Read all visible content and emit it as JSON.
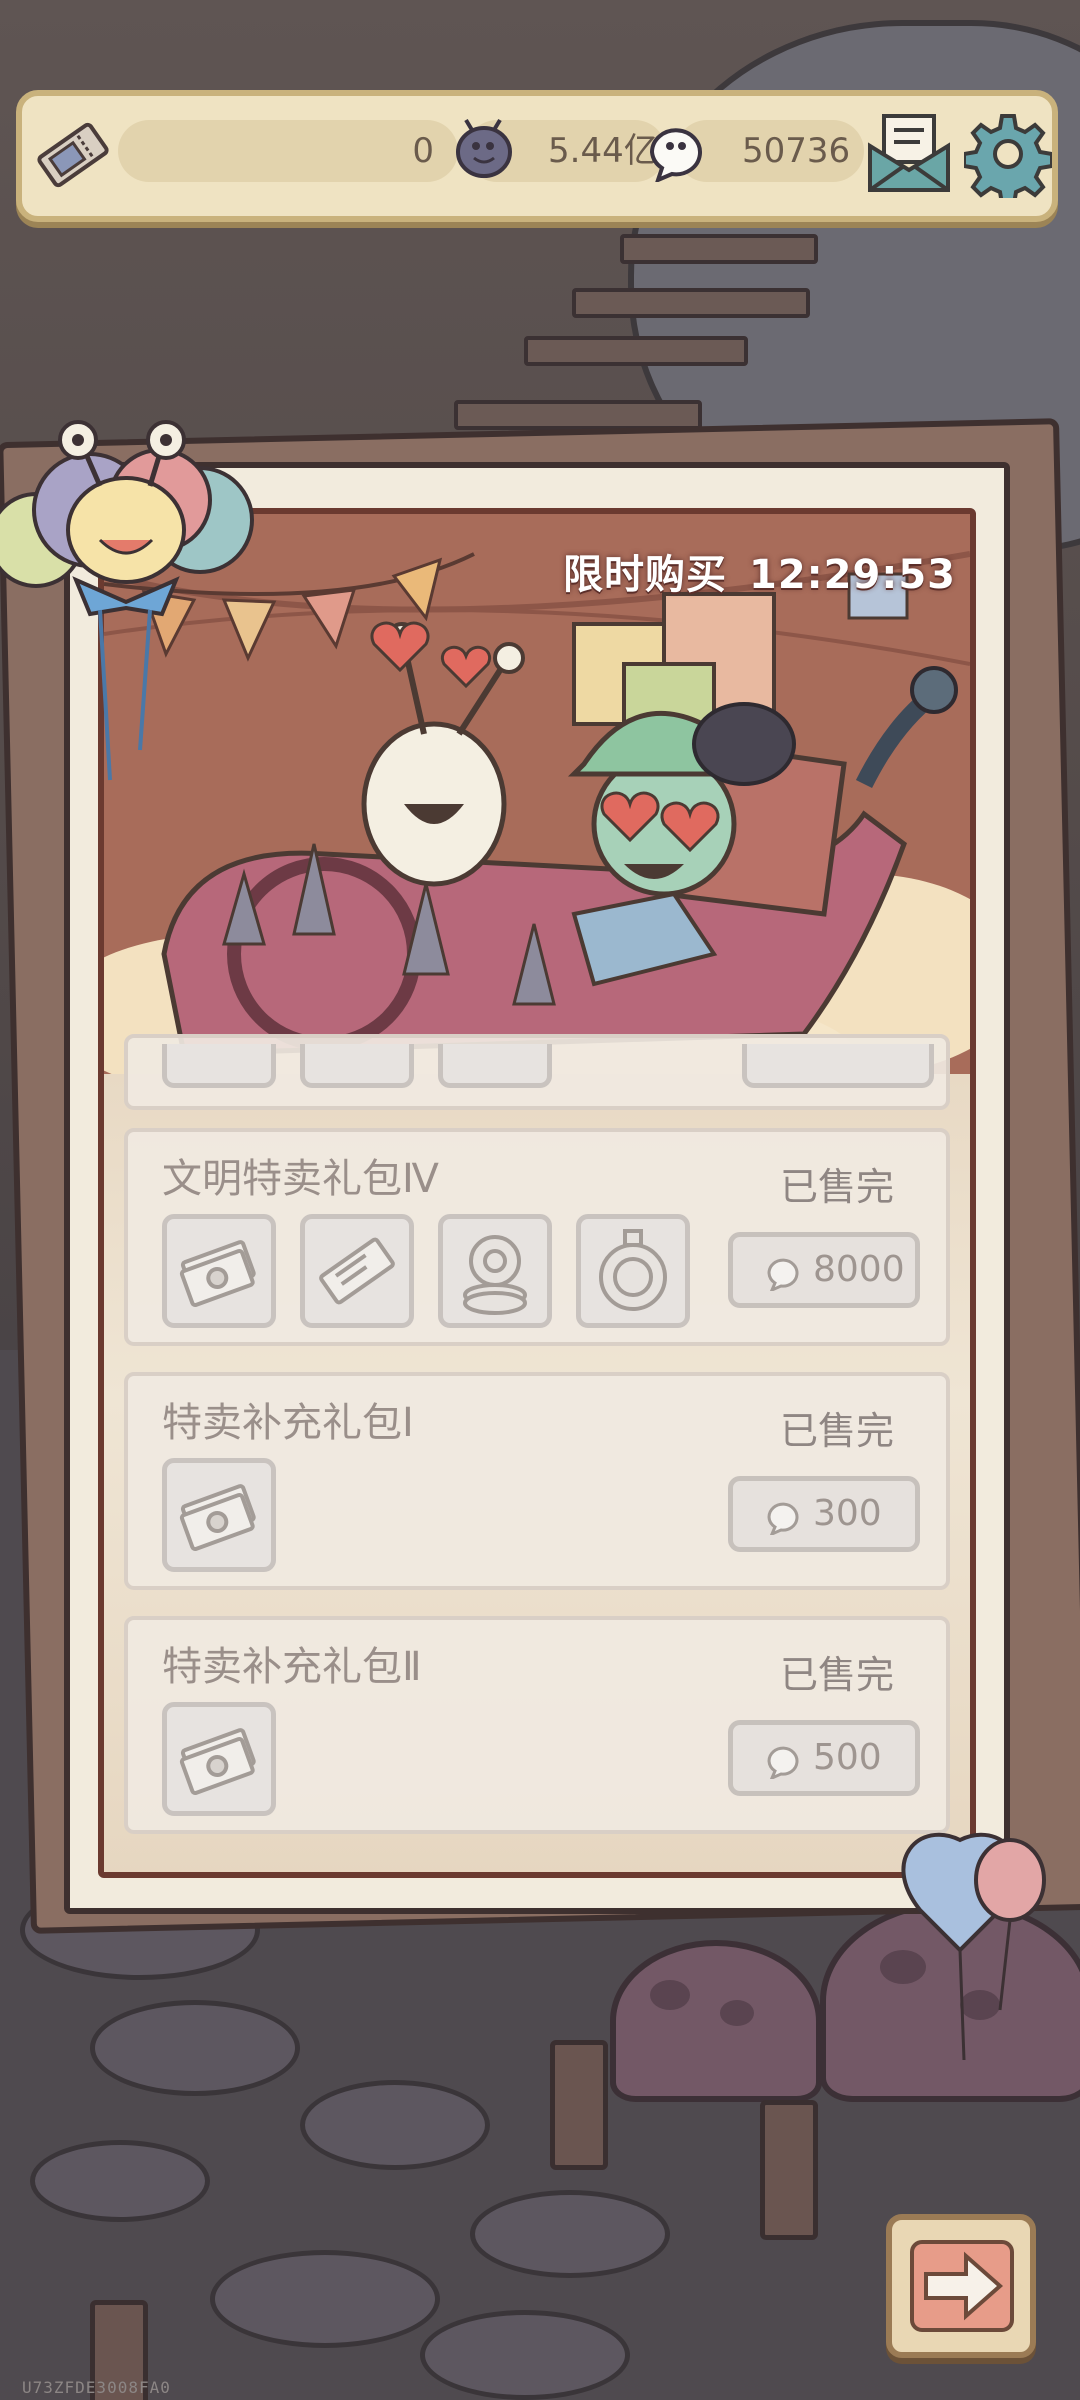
{
  "currency": {
    "tickets": "0",
    "coins": "5.44亿",
    "gems": "50736"
  },
  "icons": {
    "ticket": "ticket-icon",
    "coin": "snail-coin-icon",
    "gem": "white-snail-gem-icon",
    "mail": "mail-icon",
    "settings": "gear-icon",
    "next": "arrow-right-icon"
  },
  "banner": {
    "label": "限时购买",
    "countdown": "12:29:53"
  },
  "packs": [
    {
      "name": "文明特卖礼包Ⅳ",
      "status": "已售完",
      "price": "8000",
      "items": [
        "ticket-bundle-icon",
        "ticket-icon",
        "gear-coins-icon",
        "medal-coin-icon"
      ]
    },
    {
      "name": "特卖补充礼包Ⅰ",
      "status": "已售完",
      "price": "300",
      "items": [
        "ticket-bundle-icon"
      ]
    },
    {
      "name": "特卖补充礼包Ⅱ",
      "status": "已售完",
      "price": "500",
      "items": [
        "ticket-bundle-icon"
      ]
    }
  ],
  "footer": {
    "uid": "U73ZFDE3008FA0"
  }
}
